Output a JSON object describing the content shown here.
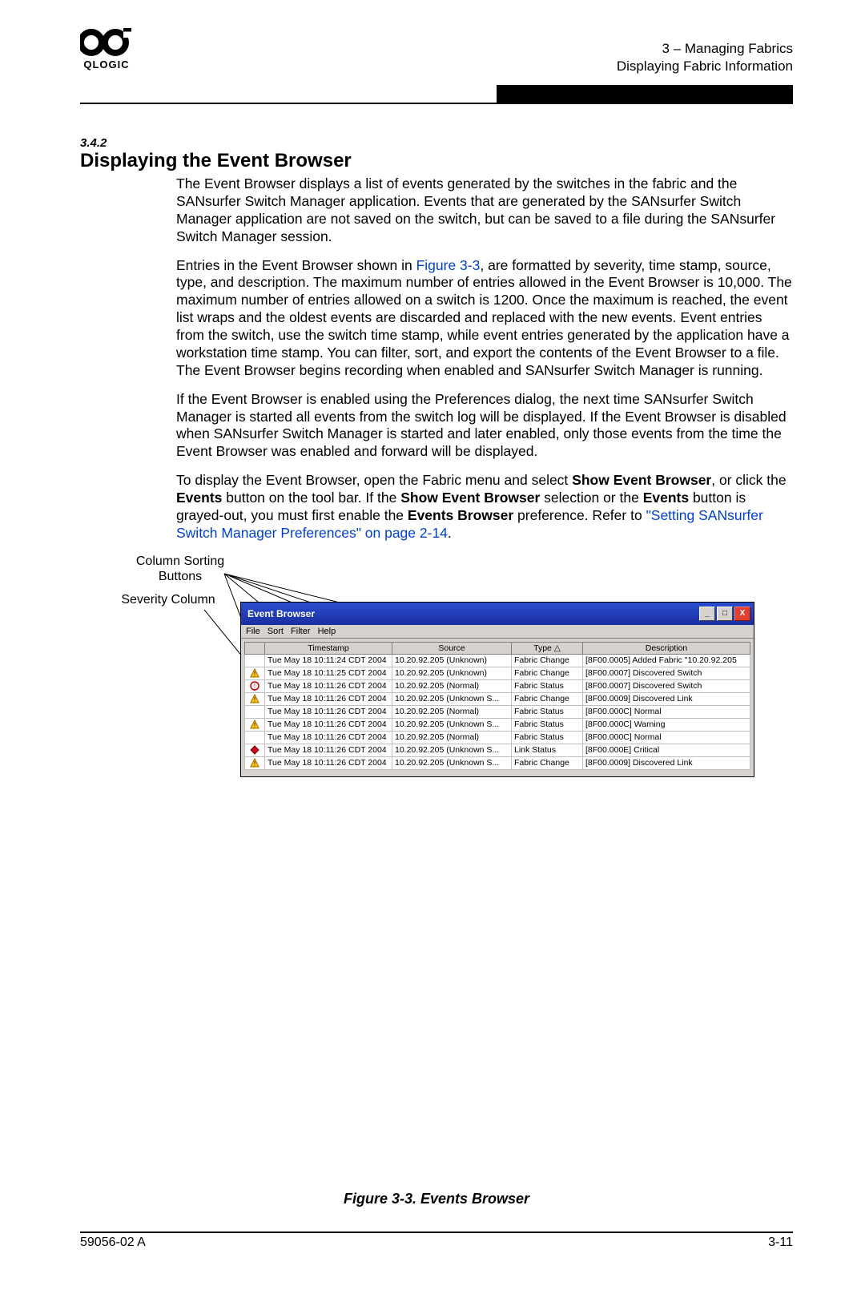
{
  "header": {
    "brand": "QLOGIC",
    "right1": "3 – Managing Fabrics",
    "right2": "Displaying Fabric Information"
  },
  "section": {
    "number": "3.4.2",
    "title": "Displaying the Event Browser"
  },
  "paragraphs": {
    "p1": "The Event Browser displays a list of events generated by the switches in the fabric and the SANsurfer Switch Manager application. Events that are generated by the SANsurfer Switch Manager application are not saved on the switch, but can be saved to a file during the SANsurfer Switch Manager session.",
    "p2a": "Entries in the Event Browser shown in ",
    "p2link": "Figure 3-3",
    "p2b": ", are formatted by severity, time stamp, source, type, and description. The maximum number of entries allowed in the Event Browser is 10,000. The maximum number of entries allowed on a switch is 1200. Once the maximum is reached, the event list wraps and the oldest events are discarded and replaced with the new events. Event entries from the switch, use the switch time stamp, while event entries generated by the application have a workstation time stamp. You can filter, sort, and export the contents of the Event Browser to a file. The Event Browser begins recording when enabled and SANsurfer Switch Manager is running.",
    "p3": "If the Event Browser is enabled using the Preferences dialog, the next time SANsurfer Switch Manager is started all events from the switch log will be displayed. If the Event Browser is disabled when SANsurfer Switch Manager is started and later enabled, only those events from the time the Event Browser was enabled and forward will be displayed.",
    "p4a": "To display the Event Browser, open the Fabric menu and select ",
    "p4b1": "Show Event Browser",
    "p4c": ", or click the ",
    "p4b2": "Events",
    "p4d": " button on the tool bar. If the ",
    "p4b3": "Show Event Browser",
    "p4e": " selection or the ",
    "p4b4": "Events",
    "p4f": " button is grayed-out, you must first enable the ",
    "p4b5": "Events Browser",
    "p4g": " preference. Refer to ",
    "p4link": "\"Setting SANsurfer Switch Manager Preferences\" on page 2-14",
    "p4h": "."
  },
  "callouts": {
    "sorting": "Column Sorting Buttons",
    "severity": "Severity Column"
  },
  "window": {
    "title": "Event Browser",
    "menus": [
      "File",
      "Sort",
      "Filter",
      "Help"
    ],
    "columns": [
      "",
      "Timestamp",
      "Source",
      "Type  △",
      "Description"
    ],
    "rows": [
      {
        "sev": "none",
        "ts": "Tue May 18 10:11:24 CDT 2004",
        "src": "10.20.92.205 (Unknown)",
        "type": "Fabric Change",
        "desc": "[8F00.0005] Added Fabric \"10.20.92.205"
      },
      {
        "sev": "warn",
        "ts": "Tue May 18 10:11:25 CDT 2004",
        "src": "10.20.92.205 (Unknown)",
        "type": "Fabric Change",
        "desc": "[8F00.0007] Discovered Switch"
      },
      {
        "sev": "info",
        "ts": "Tue May 18 10:11:26 CDT 2004",
        "src": "10.20.92.205 (Normal)",
        "type": "Fabric Status",
        "desc": "[8F00.0007] Discovered Switch"
      },
      {
        "sev": "warn",
        "ts": "Tue May 18 10:11:26 CDT 2004",
        "src": "10.20.92.205 (Unknown S...",
        "type": "Fabric Change",
        "desc": "[8F00.0009] Discovered Link"
      },
      {
        "sev": "none",
        "ts": "Tue May 18 10:11:26 CDT 2004",
        "src": "10.20.92.205 (Normal)",
        "type": "Fabric Status",
        "desc": "[8F00.000C] Normal"
      },
      {
        "sev": "warn",
        "ts": "Tue May 18 10:11:26 CDT 2004",
        "src": "10.20.92.205 (Unknown S...",
        "type": "Fabric Status",
        "desc": "[8F00.000C] Warning"
      },
      {
        "sev": "none",
        "ts": "Tue May 18 10:11:26 CDT 2004",
        "src": "10.20.92.205 (Normal)",
        "type": "Fabric Status",
        "desc": "[8F00.000C] Normal"
      },
      {
        "sev": "crit",
        "ts": "Tue May 18 10:11:26 CDT 2004",
        "src": "10.20.92.205 (Unknown S...",
        "type": "Link Status",
        "desc": "[8F00.000E] Critical"
      },
      {
        "sev": "warn",
        "ts": "Tue May 18 10:11:26 CDT 2004",
        "src": "10.20.92.205 (Unknown S...",
        "type": "Fabric Change",
        "desc": "[8F00.0009] Discovered Link"
      }
    ]
  },
  "caption": "Figure 3-3.  Events Browser",
  "footer": {
    "left": "59056-02 A",
    "right": "3-11"
  }
}
